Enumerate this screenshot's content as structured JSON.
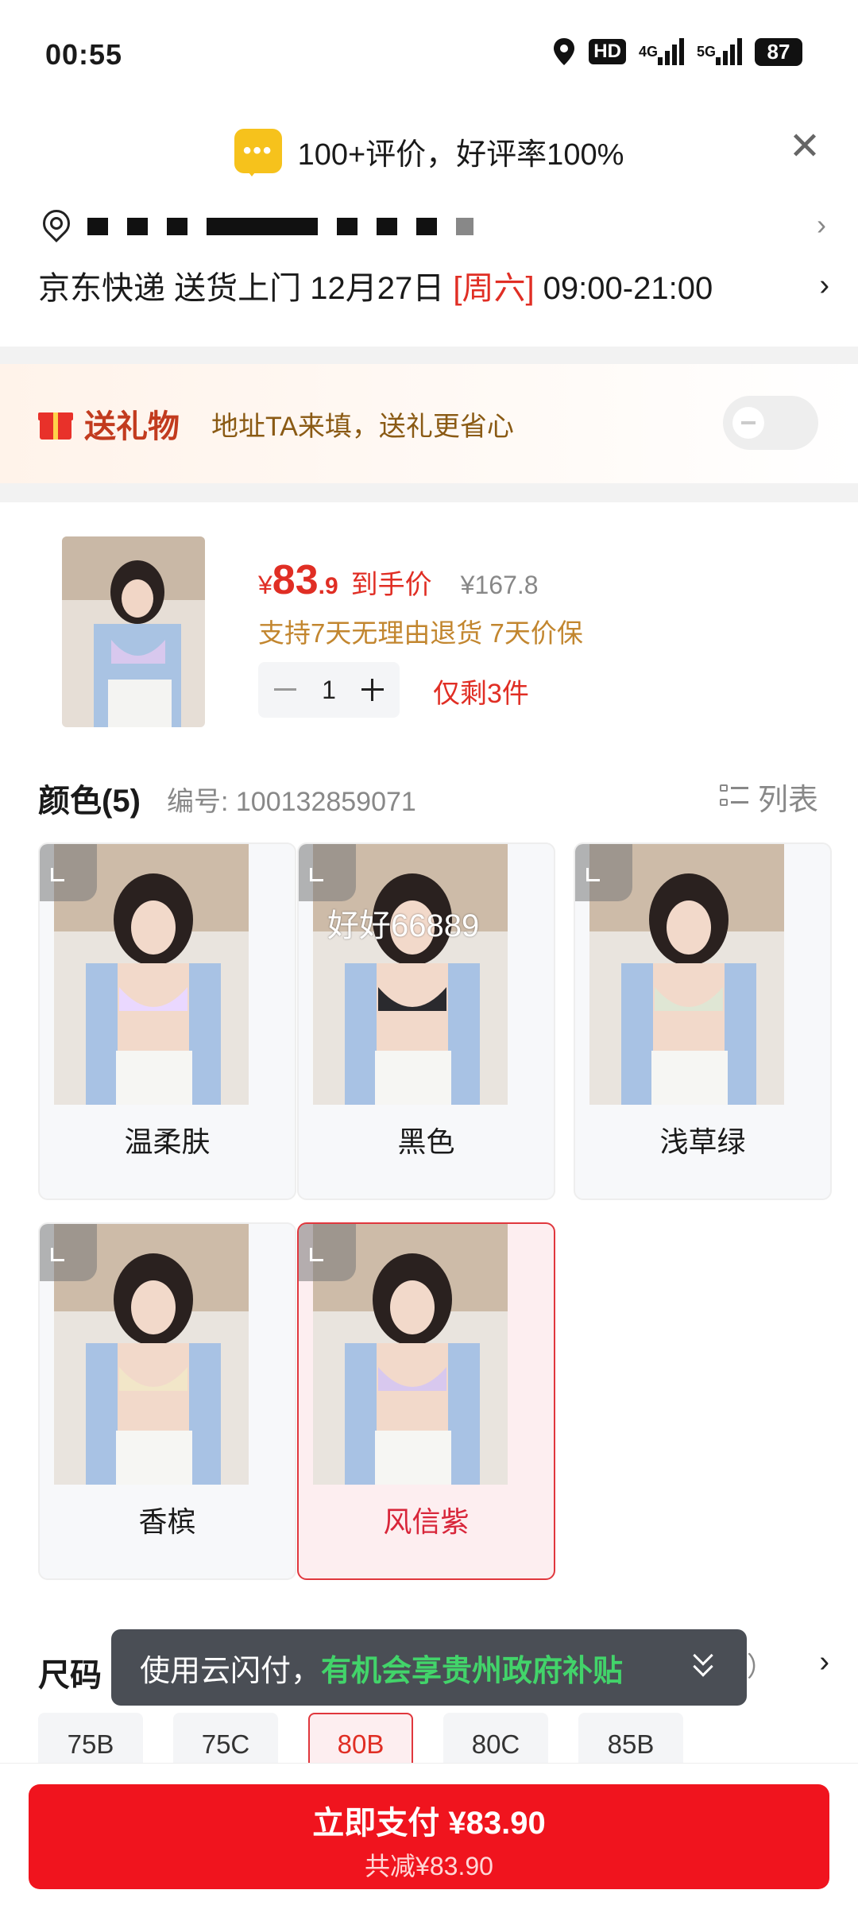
{
  "status": {
    "time": "00:55",
    "network1": "4G",
    "network2": "5G",
    "battery": "87",
    "hd": "HD"
  },
  "rating": {
    "icon": "chat-bubble-icon",
    "dots": "•••",
    "text": "100+评价，好评率100%"
  },
  "delivery": {
    "prefix": "京东快递 送货上门 12月27日 ",
    "weekday": "[周六]",
    "time": " 09:00-21:00"
  },
  "gift": {
    "title": "送礼物",
    "subtitle": "地址TA来填，送礼更省心",
    "toggle_on": false
  },
  "product": {
    "price_symbol": "¥",
    "price_int": "83",
    "price_dec": ".9",
    "price_tag": "到手价",
    "original_price": "¥167.8",
    "service": "支持7天无理由退货  7天价保",
    "quantity": "1",
    "stock": "仅剩3件"
  },
  "color_section": {
    "title": "颜色(5)",
    "code": "编号: 100132859071",
    "list_label": "列表",
    "watermark": "好好66889",
    "options": [
      {
        "label": "温柔肤",
        "selected": false,
        "tint": "#ead8ff"
      },
      {
        "label": "黑色",
        "selected": false,
        "tint": "#2a2a2e"
      },
      {
        "label": "浅草绿",
        "selected": false,
        "tint": "#dfe6d4"
      },
      {
        "label": "香槟",
        "selected": false,
        "tint": "#f2e6c8"
      },
      {
        "label": "风信紫",
        "selected": true,
        "tint": "#d8c8ee"
      }
    ]
  },
  "size_section": {
    "title": "尺码",
    "tail": "）",
    "options": [
      {
        "label": "75B",
        "selected": false
      },
      {
        "label": "75C",
        "selected": false
      },
      {
        "label": "80B",
        "selected": true
      },
      {
        "label": "80C",
        "selected": false
      },
      {
        "label": "85B",
        "selected": false
      }
    ]
  },
  "toast": {
    "text_a": "使用云闪付，",
    "text_b": "有机会享贵州政府补贴"
  },
  "pay": {
    "main": "立即支付 ¥83.90",
    "sub": "共减¥83.90"
  },
  "colors": {
    "accent": "#e02e24",
    "pay_button": "#f0141e",
    "service": "#c2862f",
    "toast_bg": "#4a4e55",
    "toast_hl": "#42d46a"
  }
}
